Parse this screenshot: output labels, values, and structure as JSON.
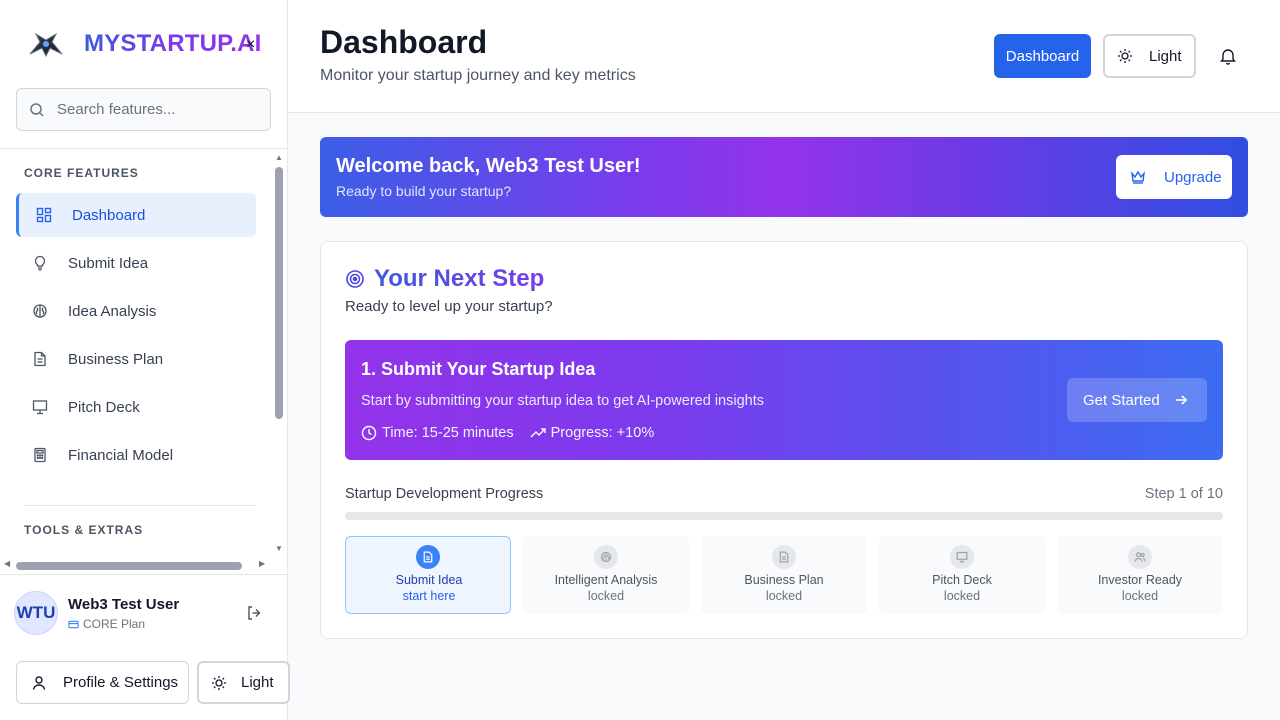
{
  "brand": {
    "name": "MYSTARTUP.AI"
  },
  "search": {
    "placeholder": "Search features..."
  },
  "sidebar": {
    "sections": [
      {
        "title": "CORE FEATURES",
        "items": [
          {
            "label": "Dashboard",
            "icon": "layout-grid-icon",
            "active": true
          },
          {
            "label": "Submit Idea",
            "icon": "lightbulb-icon"
          },
          {
            "label": "Idea Analysis",
            "icon": "brain-icon"
          },
          {
            "label": "Business Plan",
            "icon": "document-icon"
          },
          {
            "label": "Pitch Deck",
            "icon": "presentation-icon"
          },
          {
            "label": "Financial Model",
            "icon": "calculator-icon"
          }
        ]
      },
      {
        "title": "TOOLS & EXTRAS",
        "items": []
      }
    ]
  },
  "user": {
    "initials": "WTU",
    "name": "Web3 Test User",
    "plan": "CORE Plan"
  },
  "sidebar_footer": {
    "profile_label": "Profile & Settings",
    "theme_label": "Light"
  },
  "header": {
    "title": "Dashboard",
    "subtitle": "Monitor your startup journey and key metrics",
    "dashboard_button": "Dashboard",
    "theme_button": "Light"
  },
  "welcome": {
    "title": "Welcome back, Web3 Test User!",
    "subtitle": "Ready to build your startup?",
    "upgrade_label": "Upgrade"
  },
  "next_step": {
    "title": "Your Next Step",
    "subtitle": "Ready to level up your startup?",
    "task": {
      "title": "1. Submit Your Startup Idea",
      "description": "Start by submitting your startup idea to get AI-powered insights",
      "time": "Time: 15-25 minutes",
      "progress": "Progress: +10%",
      "button": "Get Started"
    },
    "progress_label": "Startup Development Progress",
    "progress_step": "Step 1 of 10",
    "progress_value": 0,
    "steps": [
      {
        "name": "Submit Idea",
        "state": "start here",
        "current": true
      },
      {
        "name": "Intelligent Analysis",
        "state": "locked"
      },
      {
        "name": "Business Plan",
        "state": "locked"
      },
      {
        "name": "Pitch Deck",
        "state": "locked"
      },
      {
        "name": "Investor Ready",
        "state": "locked"
      }
    ]
  },
  "colors": {
    "primary": "#2563eb",
    "gradient_start": "#3b5fe6",
    "gradient_mid": "#9333ea"
  }
}
